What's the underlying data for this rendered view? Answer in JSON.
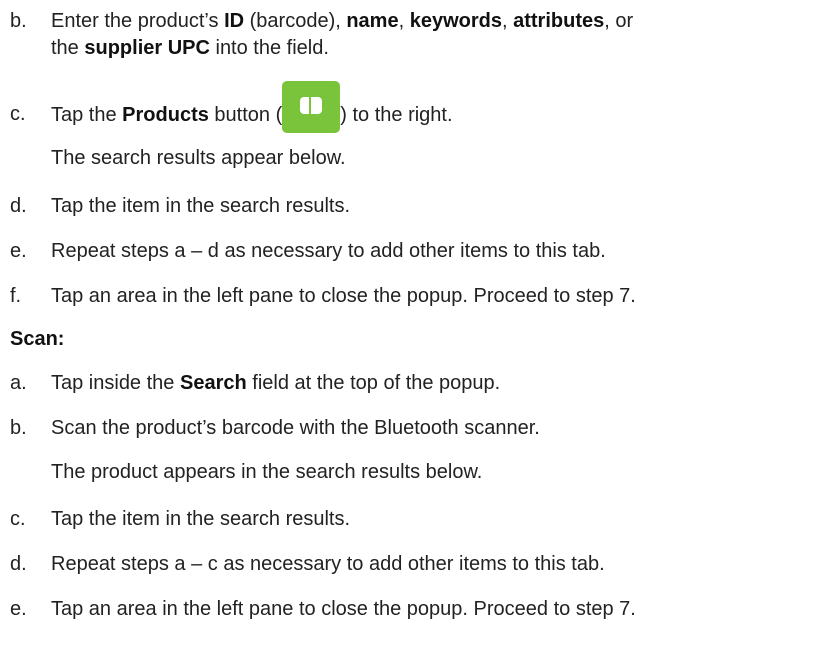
{
  "section1": {
    "step_b": {
      "letter": "b.",
      "line1_part1": "Enter the product’s ",
      "id_label": "ID",
      "line1_part2": " (barcode), ",
      "name_label": "name",
      "comma1": ", ",
      "keywords_label": "keywords",
      "comma2": ", ",
      "attributes_label": "attributes",
      "line1_part3": ", or",
      "line2_part1": "the ",
      "supplier_upc_label": "supplier UPC",
      "line2_part2": " into the field."
    },
    "step_c": {
      "letter": "c.",
      "part1": "Tap the ",
      "products_label": "Products",
      "part2": " button (",
      "icon": "products-button-icon",
      "part3": ") to the right.",
      "note": "The search results appear below."
    },
    "step_d": {
      "letter": "d.",
      "text": "Tap the item in the search results."
    },
    "step_e": {
      "letter": "e.",
      "text": "Repeat steps a – d as necessary to add other items to this tab."
    },
    "step_f": {
      "letter": "f.",
      "text": "Tap an area in the left pane to close the popup. Proceed to step 7."
    }
  },
  "scan": {
    "heading": "Scan:",
    "step_a": {
      "letter": "a.",
      "part1": "Tap inside the ",
      "search_label": "Search",
      "part2": " field at the top of the popup."
    },
    "step_b": {
      "letter": "b.",
      "text": "Scan the product’s barcode with the Bluetooth scanner.",
      "note": "The product appears in the search results below."
    },
    "step_c": {
      "letter": "c.",
      "text": "Tap the item in the search results."
    },
    "step_d": {
      "letter": "d.",
      "text": "Repeat steps a – c as necessary to add other items to this tab."
    },
    "step_e": {
      "letter": "e.",
      "text": "Tap an area in the left pane to close the popup. Proceed to step 7."
    }
  },
  "colors": {
    "products_button": "#79c43a",
    "text": "#222222"
  }
}
